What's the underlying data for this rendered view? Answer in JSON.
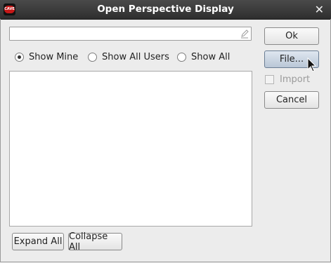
{
  "window": {
    "title": "Open Perspective Display",
    "app_icon_text": "CAVE"
  },
  "search": {
    "value": "",
    "placeholder": ""
  },
  "radio_options": [
    {
      "label": "Show Mine",
      "checked": true
    },
    {
      "label": "Show All Users",
      "checked": false
    },
    {
      "label": "Show All",
      "checked": false
    }
  ],
  "buttons": {
    "ok": "Ok",
    "file": "File...",
    "cancel": "Cancel",
    "expand_all": "Expand All",
    "collapse_all": "Collapse All"
  },
  "import": {
    "label": "Import",
    "checked": false,
    "enabled": false
  },
  "colors": {
    "titlebar": "#353535",
    "hover_button": "#c4d0de",
    "disabled_text": "#9b9b9b"
  }
}
